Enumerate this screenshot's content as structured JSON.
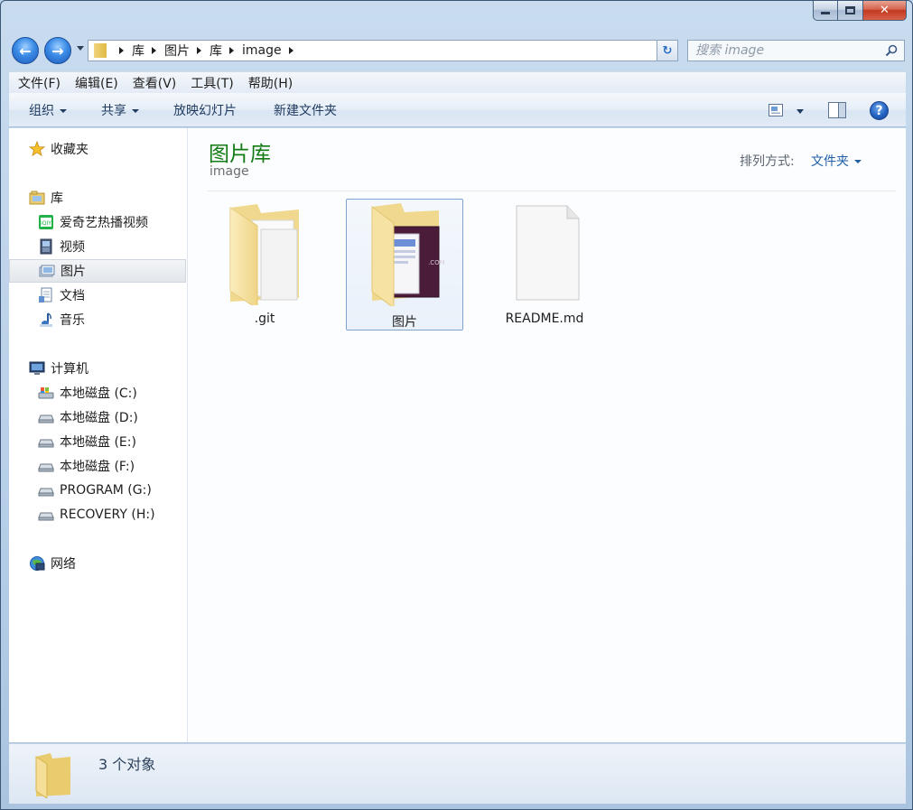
{
  "window": {
    "close_glyph": "✕"
  },
  "nav": {
    "back_glyph": "←",
    "forward_glyph": "→",
    "breadcrumbs": [
      "库",
      "图片",
      "库",
      "image"
    ],
    "refresh_glyph": "↻",
    "search_placeholder": "搜索 image"
  },
  "menu": {
    "items": [
      "文件(F)",
      "编辑(E)",
      "查看(V)",
      "工具(T)",
      "帮助(H)"
    ]
  },
  "toolbar": {
    "organize": "组织",
    "share": "共享",
    "slideshow": "放映幻灯片",
    "new_folder": "新建文件夹",
    "help_glyph": "?"
  },
  "sidebar": {
    "favorites": {
      "label": "收藏夹",
      "icon": "star-icon"
    },
    "libraries": {
      "label": "库",
      "items": [
        {
          "label": "爱奇艺热播视频",
          "icon": "iqiyi-icon"
        },
        {
          "label": "视频",
          "icon": "video-library-icon"
        },
        {
          "label": "图片",
          "icon": "pictures-library-icon",
          "selected": true
        },
        {
          "label": "文档",
          "icon": "documents-library-icon"
        },
        {
          "label": "音乐",
          "icon": "music-library-icon"
        }
      ]
    },
    "computer": {
      "label": "计算机",
      "items": [
        {
          "label": "本地磁盘 (C:)",
          "icon": "system-drive-icon"
        },
        {
          "label": "本地磁盘 (D:)",
          "icon": "drive-icon"
        },
        {
          "label": "本地磁盘 (E:)",
          "icon": "drive-icon"
        },
        {
          "label": "本地磁盘 (F:)",
          "icon": "drive-icon"
        },
        {
          "label": "PROGRAM (G:)",
          "icon": "drive-icon"
        },
        {
          "label": "RECOVERY (H:)",
          "icon": "drive-icon"
        }
      ]
    },
    "network": {
      "label": "网络",
      "icon": "network-icon"
    }
  },
  "library_header": {
    "title": "图片库",
    "subtitle": "image",
    "arrange_label": "排列方式:",
    "arrange_value": "文件夹"
  },
  "files": [
    {
      "name": ".git",
      "type": "folder"
    },
    {
      "name": "图片",
      "type": "folder-with-images",
      "selected": true
    },
    {
      "name": "README.md",
      "type": "file"
    }
  ],
  "status": {
    "text": "3 个对象"
  },
  "colors": {
    "library_title": "#137b13",
    "link_blue": "#1e5fa6",
    "selection_border": "#7da2ce"
  }
}
